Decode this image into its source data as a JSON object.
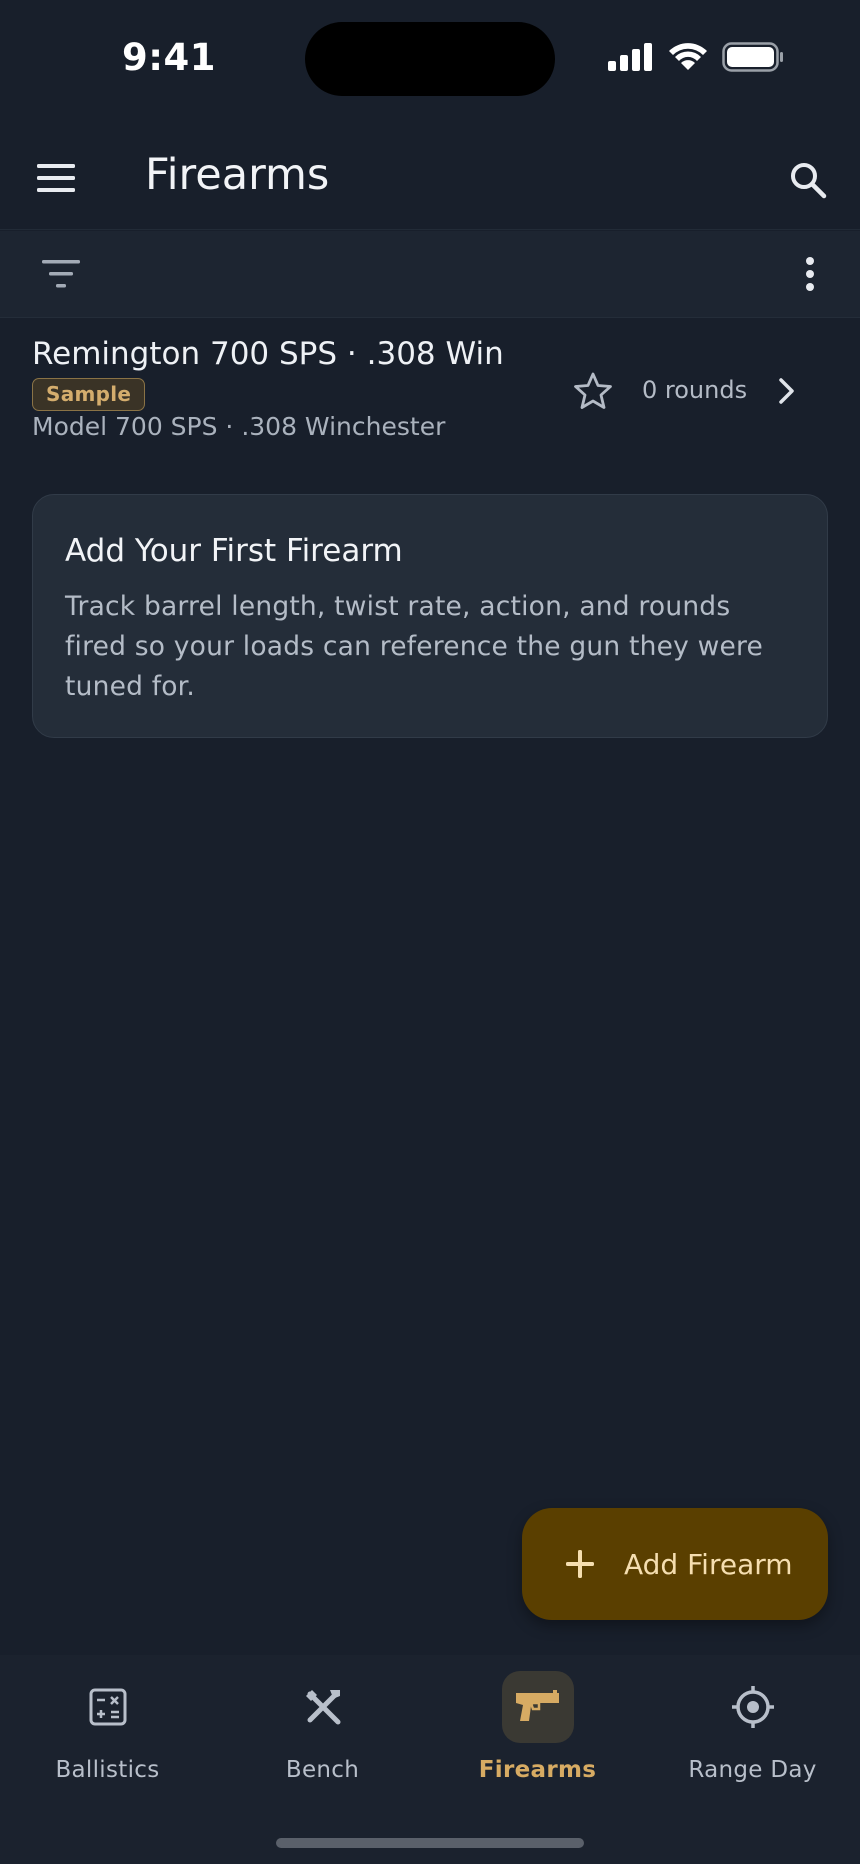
{
  "status_bar": {
    "time": "9:41"
  },
  "app_bar": {
    "title": "Firearms"
  },
  "list": {
    "items": [
      {
        "title": "Remington 700 SPS · .308 Win",
        "badge": "Sample",
        "subtitle": "Model 700 SPS · .308 Winchester",
        "rounds": "0 rounds"
      }
    ]
  },
  "info_card": {
    "title": "Add Your First Firearm",
    "body": "Track barrel length, twist rate, action, and rounds fired so your loads can reference the gun they were tuned for."
  },
  "fab": {
    "label": "Add Firearm"
  },
  "bottom_nav": {
    "items": [
      {
        "label": "Ballistics",
        "icon": "calculator-icon"
      },
      {
        "label": "Bench",
        "icon": "tools-icon"
      },
      {
        "label": "Firearms",
        "icon": "pistol-icon"
      },
      {
        "label": "Range Day",
        "icon": "crosshair-icon"
      }
    ],
    "active": "Firearms"
  },
  "colors": {
    "background": "#181f2b",
    "accent": "#d7ab63",
    "fab_background": "#5a3f00",
    "card_background": "#242d39"
  }
}
